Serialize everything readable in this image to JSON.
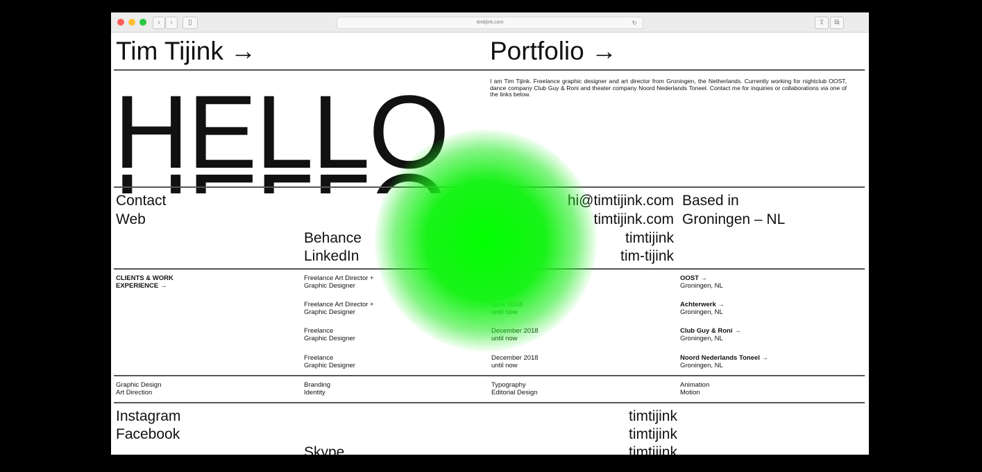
{
  "browser": {
    "url": "timtijink.com",
    "back_icon": "chevron-left-icon",
    "forward_icon": "chevron-right-icon",
    "sidebar_icon": "sidebar-icon",
    "reload_icon": "reload-icon",
    "share_icon": "share-icon",
    "tabs_icon": "tabs-icon",
    "colors": {
      "close": "#fd5f57",
      "minimize": "#febd2e",
      "zoom": "#28c840"
    }
  },
  "header": {
    "name": "Tim Tijink →",
    "portfolio": "Portfolio →"
  },
  "hero": {
    "word": "HELLO",
    "bio": "I am Tim Tijink. Freelance graphic designer and art director from Groningen, the Netherlands. Currently working for nightclub OOST, dance company Club Guy & Roni and theater company Noord Nederlands Toneel. Contact me for inquiries or collaborations via one of the links below."
  },
  "contact": {
    "contact_label": "Contact",
    "web_label": "Web",
    "email": "hi@timtijink.com",
    "website": "timtijink.com",
    "behance_label": "Behance",
    "behance_handle": "timtijink",
    "linkedin_label": "LinkedIn",
    "linkedin_handle": "tim-tijink",
    "based_label": "Based in",
    "location": "Groningen – NL"
  },
  "experience": {
    "heading_line1": "CLIENTS & WORK",
    "heading_line2": "EXPERIENCE →",
    "jobs": [
      {
        "role1": "Freelance Art Director +",
        "role2": "Graphic Designer",
        "date1": "June 2018",
        "date2": "until now",
        "client": "OOST →",
        "city": "Groningen, NL"
      },
      {
        "role1": "Freelance Art Director +",
        "role2": "Graphic Designer",
        "date1": "June 2018",
        "date2": "until now",
        "client": "Achterwerk →",
        "city": "Groningen, NL"
      },
      {
        "role1": "Freelance",
        "role2": "Graphic Designer",
        "date1": "December 2018",
        "date2": "until now",
        "client": "Club Guy & Roni →",
        "city": "Groningen, NL"
      },
      {
        "role1": "Freelance",
        "role2": "Graphic Designer",
        "date1": "December 2018",
        "date2": "until now",
        "client": "Noord Nederlands Toneel →",
        "city": "Groningen, NL"
      }
    ]
  },
  "skills": [
    {
      "a": "Graphic Design",
      "b": "Art Direction"
    },
    {
      "a": "Branding",
      "b": "Identity"
    },
    {
      "a": "Typography",
      "b": "Editorial Design"
    },
    {
      "a": "Animation",
      "b": "Motion"
    }
  ],
  "social": {
    "instagram_label": "Instagram",
    "instagram_handle": "timtijink",
    "facebook_label": "Facebook",
    "facebook_handle": "timtijink",
    "skype_label": "Skype",
    "skype_handle": "timtijink"
  },
  "accent": "#00ff00"
}
